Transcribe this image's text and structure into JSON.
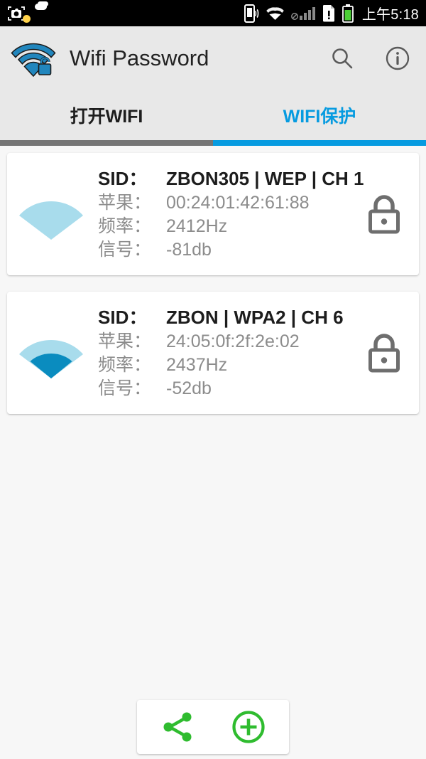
{
  "statusbar": {
    "time": "上午5:18",
    "icons_left": [
      "screenshot-camera-icon",
      "weather-icon"
    ],
    "icons_right": [
      "phone-sound-icon",
      "wifi-icon",
      "no-cellular-signal-icon",
      "sim-card-alert-icon",
      "battery-icon"
    ],
    "background": "#000000"
  },
  "appbar": {
    "logo": "wifi-unlocked-logo",
    "title": "Wifi Password",
    "search_icon": "search-icon",
    "info_icon": "info-icon",
    "background": "#e8e8e8"
  },
  "tabs": {
    "items": [
      {
        "label": "打开WIFI",
        "active": false,
        "indicator_color": "#757575"
      },
      {
        "label": "WIFI保护",
        "active": true,
        "indicator_color": "#069be0"
      }
    ],
    "active_color": "#069be0",
    "inactive_color": "#1d1d1d"
  },
  "networks": [
    {
      "signal_icon": "wifi-signal-weak-icon",
      "signal_level": 1,
      "lock_icon": "lock-closed-icon",
      "title_label": "SID：",
      "title_value": "ZBON305 | WEP | CH 1",
      "ssid": "ZBON305",
      "security": "WEP",
      "channel": "CH 1",
      "mac_label": "苹果：",
      "mac_value": "00:24:01:42:61:88",
      "freq_label": "频率：",
      "freq_value": "2412Hz",
      "signal_label": "信号：",
      "signal_value": "-81db"
    },
    {
      "signal_icon": "wifi-signal-strong-icon",
      "signal_level": 3,
      "lock_icon": "lock-closed-icon",
      "title_label": "SID：",
      "title_value": "ZBON | WPA2 | CH 6",
      "ssid": "ZBON",
      "security": "WPA2",
      "channel": "CH 6",
      "mac_label": "苹果：",
      "mac_value": "24:05:0f:2f:2e:02",
      "freq_label": "频率：",
      "freq_value": "2437Hz",
      "signal_label": "信号：",
      "signal_value": "-52db"
    }
  ],
  "bottombar": {
    "share_icon": "share-icon",
    "add_icon": "add-circle-icon",
    "accent_color": "#2fbc2f"
  },
  "colors": {
    "page_background": "#f7f7f7",
    "card_background": "#ffffff",
    "label_gray": "#8c8c8c",
    "wifi_light": "#a8dcec",
    "wifi_dark": "#0a8cbf",
    "lock_gray": "#6e6e6e"
  }
}
